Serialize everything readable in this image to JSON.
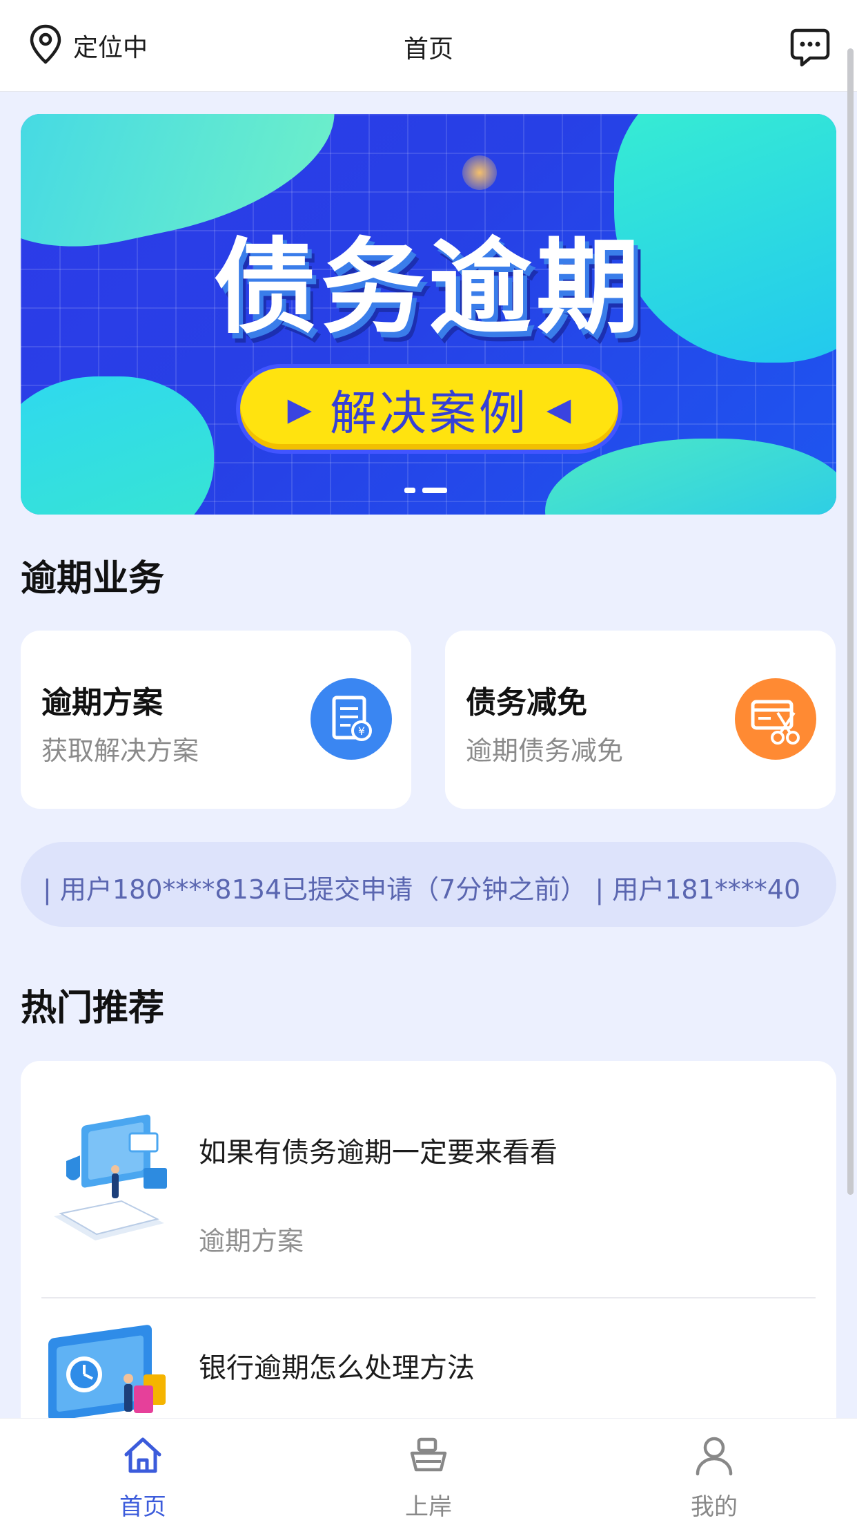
{
  "header": {
    "location_text": "定位中",
    "title": "首页",
    "location_icon": "location-pin-icon",
    "message_icon": "chat-bubble-icon"
  },
  "banner": {
    "headline": "债务逾期",
    "button_text": "解决案例",
    "slides_total": 2,
    "active_slide": 2,
    "colors": {
      "bg": "#2a3fe8",
      "pill": "#ffe30f",
      "accent_teal": "#33e6cf"
    }
  },
  "overdue_section": {
    "title": "逾期业务",
    "cards": [
      {
        "title": "逾期方案",
        "subtitle": "获取解决方案",
        "icon": "document-plan-icon",
        "icon_color": "#3a86f2"
      },
      {
        "title": "债务减免",
        "subtitle": "逾期债务减免",
        "icon": "card-scissors-icon",
        "icon_color": "#ff8a33"
      }
    ]
  },
  "ticker": {
    "text": "| 用户180****8134已提交申请（7分钟之前） | 用户181****40"
  },
  "hot_section": {
    "title": "热门推荐",
    "items": [
      {
        "title": "如果有债务逾期一定要来看看",
        "tag": "逾期方案",
        "image": "security-laptop-illustration"
      },
      {
        "title": "银行逾期怎么处理方法",
        "tag": "",
        "image": "shopping-laptop-illustration"
      }
    ]
  },
  "tabbar": {
    "active_color": "#3b5bdb",
    "inactive_color": "#888888",
    "tabs": [
      {
        "label": "首页",
        "icon": "home-icon",
        "active": true
      },
      {
        "label": "上岸",
        "icon": "boat-icon",
        "active": false
      },
      {
        "label": "我的",
        "icon": "user-icon",
        "active": false
      }
    ]
  }
}
